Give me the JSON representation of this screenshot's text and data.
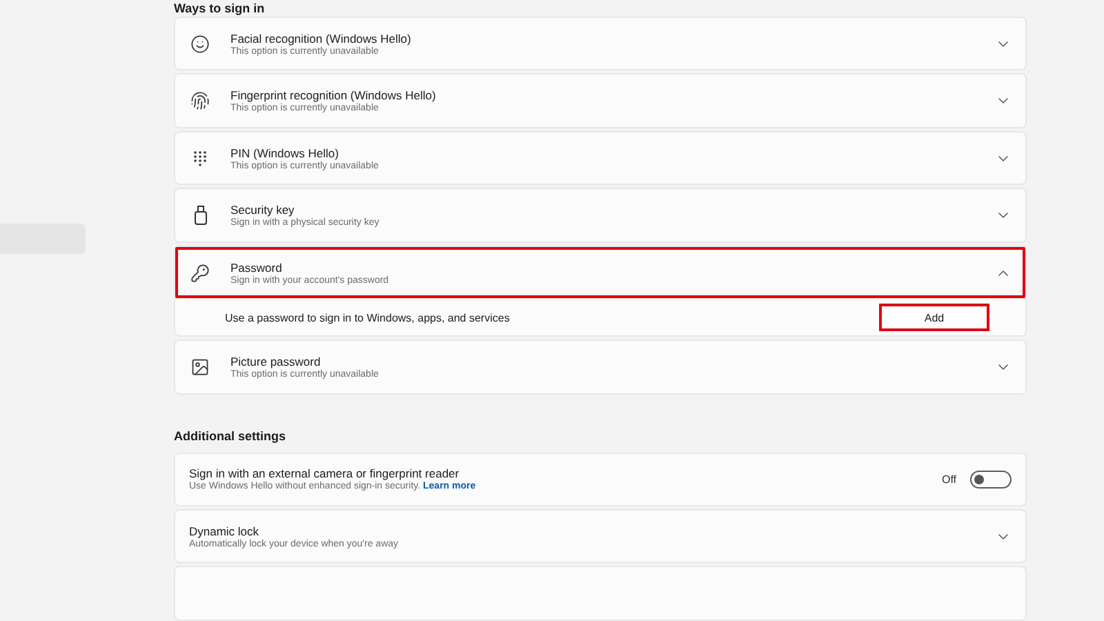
{
  "sidebar": {
    "items": [
      {
        "selected": true
      }
    ]
  },
  "sign_in": {
    "heading": "Ways to sign in",
    "options": [
      {
        "kind": "face",
        "title": "Facial recognition (Windows Hello)",
        "subtitle": "This option is currently unavailable",
        "expanded": false,
        "highlighted": false
      },
      {
        "kind": "fingerprint",
        "title": "Fingerprint recognition (Windows Hello)",
        "subtitle": "This option is currently unavailable",
        "expanded": false,
        "highlighted": false
      },
      {
        "kind": "pin",
        "title": "PIN (Windows Hello)",
        "subtitle": "This option is currently unavailable",
        "expanded": false,
        "highlighted": false
      },
      {
        "kind": "security-key",
        "title": "Security key",
        "subtitle": "Sign in with a physical security key",
        "expanded": false,
        "highlighted": false
      },
      {
        "kind": "password",
        "title": "Password",
        "subtitle": "Sign in with your account's password",
        "expanded": true,
        "highlighted": true,
        "detail": {
          "text": "Use a password to sign in to Windows, apps, and services",
          "button": {
            "label": "Add",
            "highlighted": true
          }
        }
      },
      {
        "kind": "picture",
        "title": "Picture password",
        "subtitle": "This option is currently unavailable",
        "expanded": false,
        "highlighted": false
      }
    ]
  },
  "additional": {
    "heading": "Additional settings",
    "items": [
      {
        "kind": "toggle",
        "title": "Sign in with an external camera or fingerprint reader",
        "subtitle": "Use Windows Hello without enhanced sign-in security.",
        "link": "Learn more",
        "state_label": "Off",
        "on": false
      },
      {
        "kind": "expand",
        "title": "Dynamic lock",
        "subtitle": "Automatically lock your device when you're away",
        "expanded": false
      },
      {
        "kind": "blank"
      }
    ]
  }
}
